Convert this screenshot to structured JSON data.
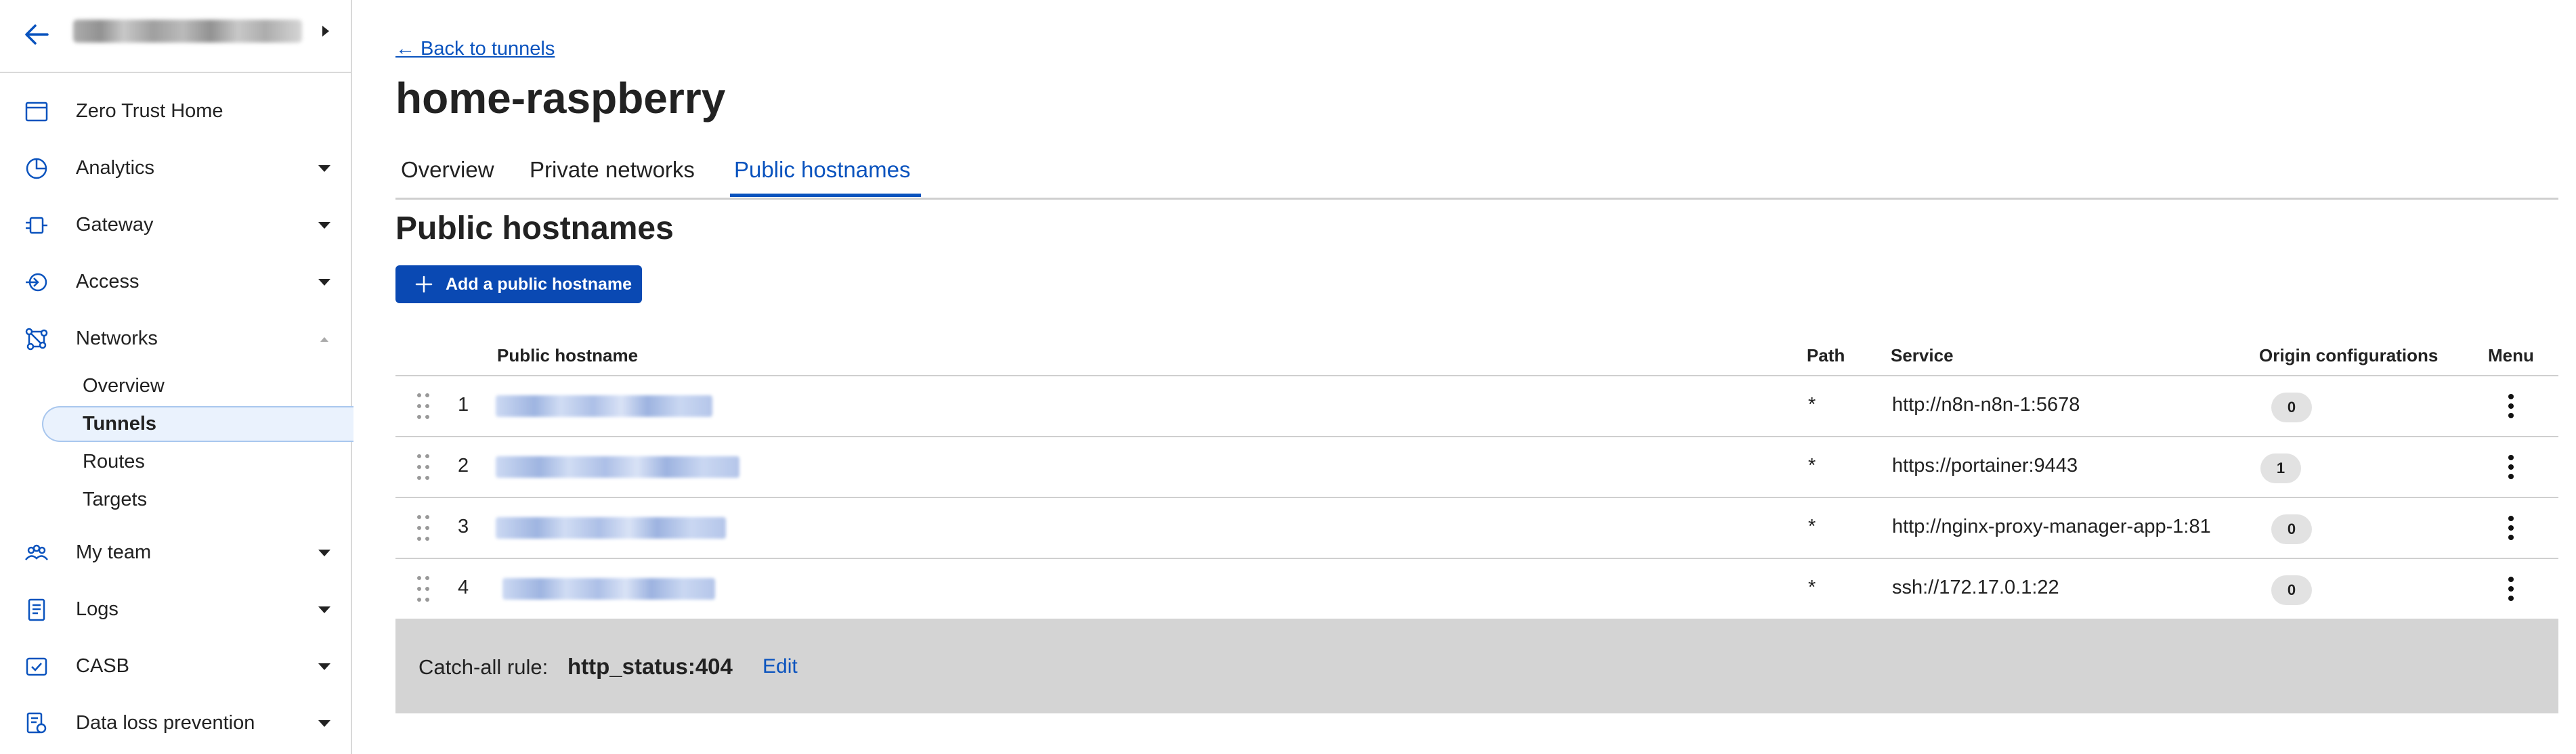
{
  "colors": {
    "accent": "#0a53be",
    "button_bg": "#0a49b3",
    "catchall_bg": "#d4d4d4",
    "badge_bg": "#e2e2e2"
  },
  "sidebar": {
    "items": [
      {
        "label": "Zero Trust Home",
        "icon": "home-window-icon"
      },
      {
        "label": "Analytics",
        "icon": "pie-chart-icon"
      },
      {
        "label": "Gateway",
        "icon": "gateway-icon"
      },
      {
        "label": "Access",
        "icon": "access-icon"
      },
      {
        "label": "Networks",
        "icon": "networks-icon",
        "expanded": true
      },
      {
        "label": "My team",
        "icon": "team-icon"
      },
      {
        "label": "Logs",
        "icon": "logs-icon"
      },
      {
        "label": "CASB",
        "icon": "casb-icon"
      },
      {
        "label": "Data loss prevention",
        "icon": "dlp-icon"
      }
    ],
    "networks_sub": [
      "Overview",
      "Tunnels",
      "Routes",
      "Targets"
    ],
    "active_sub": "Tunnels"
  },
  "main": {
    "back_link": "← Back to tunnels",
    "title": "home-raspberry",
    "tabs": [
      {
        "label": "Overview"
      },
      {
        "label": "Private networks"
      },
      {
        "label": "Public hostnames",
        "active": true
      }
    ],
    "section_title": "Public hostnames",
    "add_button": "Add a public hostname",
    "table": {
      "headers": [
        "Public hostname",
        "Path",
        "Service",
        "Origin configurations",
        "Menu"
      ],
      "rows": [
        {
          "num": "1",
          "path": "*",
          "service": "http://n8n-n8n-1:5678",
          "origin_configs": "0"
        },
        {
          "num": "2",
          "path": "*",
          "service": "https://portainer:9443",
          "origin_configs": "1"
        },
        {
          "num": "3",
          "path": "*",
          "service": "http://nginx-proxy-manager-app-1:81",
          "origin_configs": "0"
        },
        {
          "num": "4",
          "path": "*",
          "service": "ssh://172.17.0.1:22",
          "origin_configs": "0"
        }
      ]
    },
    "catchall": {
      "label": "Catch-all rule:",
      "value": "http_status:404",
      "edit": "Edit"
    }
  }
}
